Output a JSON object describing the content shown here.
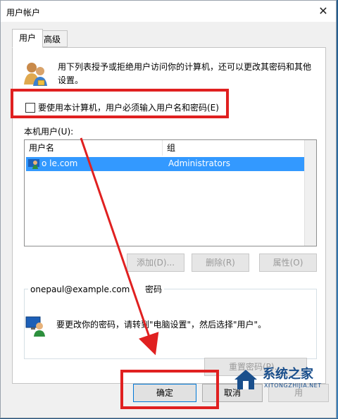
{
  "window": {
    "title": "用户帐户",
    "close_glyph": "✕"
  },
  "tabs": [
    {
      "label": "用户"
    },
    {
      "label": "高级"
    }
  ],
  "description": "用下列表授予或拒绝用户访问你的计算机，还可以更改其密码和其他设置。",
  "checkbox": {
    "label": "要使用本计算机，用户必须输入用户名和密码(E)",
    "checked": false
  },
  "users_section": {
    "label": "本机用户(U):",
    "columns": [
      "用户名",
      "组"
    ],
    "rows": [
      {
        "username": "o                   le.com",
        "group": "Administrators"
      }
    ]
  },
  "buttons": {
    "add": "添加(D)...",
    "remove": "删除(R)",
    "properties": "属性(O)"
  },
  "password_group": {
    "legend": "onepaul@example.com 的密码",
    "legend_visible_prefix": "onepaul@example.com",
    "legend_visible_suffix": "密码",
    "text": "要更改你的密码，请转到\"电脑设置\"，然后选择\"用户\"。",
    "reset_button": "重置密码(P)..."
  },
  "footer": {
    "ok": "确定",
    "cancel": "取消",
    "apply": "用"
  },
  "watermark": {
    "brand": "系统之家",
    "sub": "XITONGZHIJIA.NET"
  },
  "colors": {
    "annotation_red": "#e02020",
    "selection_blue": "#3399ff"
  }
}
